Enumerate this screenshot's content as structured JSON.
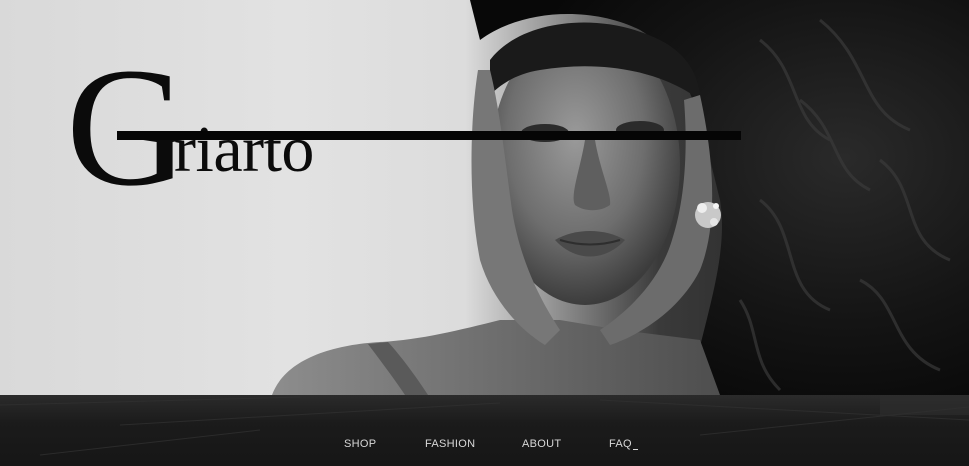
{
  "hero": {
    "image_alt": "black and white portrait of a model with curly hair and hands framing the face",
    "colors": {
      "background_light": "#dcdcdc",
      "hair_dark": "#161616",
      "skin_tone": "#8a8a8a"
    }
  },
  "logo": {
    "initial": "G",
    "rest": "riarto",
    "color": "#0b0b0b"
  },
  "nav": {
    "items": [
      {
        "label": "SHOP"
      },
      {
        "label": "FASHION"
      },
      {
        "label": "ABOUT"
      },
      {
        "label": "FAQ"
      }
    ],
    "text_color": "#d8d8d8",
    "background": "#1b1b1b"
  }
}
